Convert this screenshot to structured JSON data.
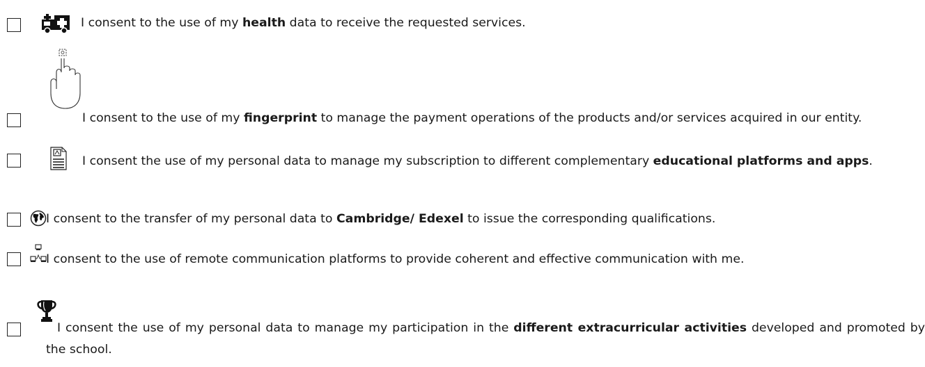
{
  "consents": [
    {
      "icon": "ambulance-icon",
      "pre": "I consent to the use of my ",
      "bold": "health",
      "post": " data to receive the requested services."
    },
    {
      "icon": "fingerprint-touch-icon",
      "pre": "I consent to the use of my ",
      "bold": "fingerprint",
      "post": " to manage the payment operations of the products and/or services acquired in our entity."
    },
    {
      "icon": "document-icon",
      "pre": "I consent the use of my personal data to manage my subscription to different complementary ",
      "bold": "educational platforms and apps",
      "post": "."
    },
    {
      "icon": "globe-icon",
      "pre": "I consent to the transfer of my personal data to ",
      "bold": "Cambridge/ Edexel",
      "post": " to issue the corresponding qualifications."
    },
    {
      "icon": "network-computers-icon",
      "pre": "I consent to the use of remote communication platforms to provide coherent and effective communication with me.",
      "bold": "",
      "post": ""
    },
    {
      "icon": "trophy-icon",
      "pre": "I consent the use of my personal data to manage my participation in the ",
      "bold": "different extracurricular activities",
      "post": " developed and promoted by the school."
    }
  ]
}
